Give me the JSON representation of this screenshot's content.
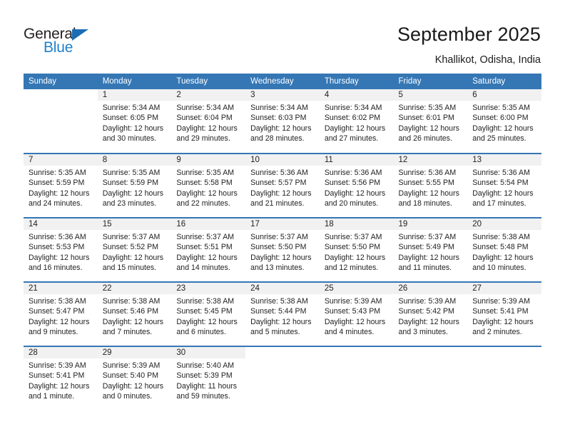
{
  "brand": {
    "name_part1": "General",
    "name_part2": "Blue",
    "accent_color": "#2081cd",
    "triangle_color": "#1b6cb5"
  },
  "header": {
    "month_title": "September 2025",
    "location": "Khallikot, Odisha, India"
  },
  "theme": {
    "header_band": "#3577b5",
    "daynum_band": "#f1f1f1",
    "text": "#222222"
  },
  "weekday_headers": [
    "Sunday",
    "Monday",
    "Tuesday",
    "Wednesday",
    "Thursday",
    "Friday",
    "Saturday"
  ],
  "weeks": [
    [
      {
        "day": "",
        "blank": true,
        "sunrise": "",
        "sunset": "",
        "daylight1": "",
        "daylight2": ""
      },
      {
        "day": "1",
        "sunrise": "Sunrise: 5:34 AM",
        "sunset": "Sunset: 6:05 PM",
        "daylight1": "Daylight: 12 hours",
        "daylight2": "and 30 minutes."
      },
      {
        "day": "2",
        "sunrise": "Sunrise: 5:34 AM",
        "sunset": "Sunset: 6:04 PM",
        "daylight1": "Daylight: 12 hours",
        "daylight2": "and 29 minutes."
      },
      {
        "day": "3",
        "sunrise": "Sunrise: 5:34 AM",
        "sunset": "Sunset: 6:03 PM",
        "daylight1": "Daylight: 12 hours",
        "daylight2": "and 28 minutes."
      },
      {
        "day": "4",
        "sunrise": "Sunrise: 5:34 AM",
        "sunset": "Sunset: 6:02 PM",
        "daylight1": "Daylight: 12 hours",
        "daylight2": "and 27 minutes."
      },
      {
        "day": "5",
        "sunrise": "Sunrise: 5:35 AM",
        "sunset": "Sunset: 6:01 PM",
        "daylight1": "Daylight: 12 hours",
        "daylight2": "and 26 minutes."
      },
      {
        "day": "6",
        "sunrise": "Sunrise: 5:35 AM",
        "sunset": "Sunset: 6:00 PM",
        "daylight1": "Daylight: 12 hours",
        "daylight2": "and 25 minutes."
      }
    ],
    [
      {
        "day": "7",
        "sunrise": "Sunrise: 5:35 AM",
        "sunset": "Sunset: 5:59 PM",
        "daylight1": "Daylight: 12 hours",
        "daylight2": "and 24 minutes."
      },
      {
        "day": "8",
        "sunrise": "Sunrise: 5:35 AM",
        "sunset": "Sunset: 5:59 PM",
        "daylight1": "Daylight: 12 hours",
        "daylight2": "and 23 minutes."
      },
      {
        "day": "9",
        "sunrise": "Sunrise: 5:35 AM",
        "sunset": "Sunset: 5:58 PM",
        "daylight1": "Daylight: 12 hours",
        "daylight2": "and 22 minutes."
      },
      {
        "day": "10",
        "sunrise": "Sunrise: 5:36 AM",
        "sunset": "Sunset: 5:57 PM",
        "daylight1": "Daylight: 12 hours",
        "daylight2": "and 21 minutes."
      },
      {
        "day": "11",
        "sunrise": "Sunrise: 5:36 AM",
        "sunset": "Sunset: 5:56 PM",
        "daylight1": "Daylight: 12 hours",
        "daylight2": "and 20 minutes."
      },
      {
        "day": "12",
        "sunrise": "Sunrise: 5:36 AM",
        "sunset": "Sunset: 5:55 PM",
        "daylight1": "Daylight: 12 hours",
        "daylight2": "and 18 minutes."
      },
      {
        "day": "13",
        "sunrise": "Sunrise: 5:36 AM",
        "sunset": "Sunset: 5:54 PM",
        "daylight1": "Daylight: 12 hours",
        "daylight2": "and 17 minutes."
      }
    ],
    [
      {
        "day": "14",
        "sunrise": "Sunrise: 5:36 AM",
        "sunset": "Sunset: 5:53 PM",
        "daylight1": "Daylight: 12 hours",
        "daylight2": "and 16 minutes."
      },
      {
        "day": "15",
        "sunrise": "Sunrise: 5:37 AM",
        "sunset": "Sunset: 5:52 PM",
        "daylight1": "Daylight: 12 hours",
        "daylight2": "and 15 minutes."
      },
      {
        "day": "16",
        "sunrise": "Sunrise: 5:37 AM",
        "sunset": "Sunset: 5:51 PM",
        "daylight1": "Daylight: 12 hours",
        "daylight2": "and 14 minutes."
      },
      {
        "day": "17",
        "sunrise": "Sunrise: 5:37 AM",
        "sunset": "Sunset: 5:50 PM",
        "daylight1": "Daylight: 12 hours",
        "daylight2": "and 13 minutes."
      },
      {
        "day": "18",
        "sunrise": "Sunrise: 5:37 AM",
        "sunset": "Sunset: 5:50 PM",
        "daylight1": "Daylight: 12 hours",
        "daylight2": "and 12 minutes."
      },
      {
        "day": "19",
        "sunrise": "Sunrise: 5:37 AM",
        "sunset": "Sunset: 5:49 PM",
        "daylight1": "Daylight: 12 hours",
        "daylight2": "and 11 minutes."
      },
      {
        "day": "20",
        "sunrise": "Sunrise: 5:38 AM",
        "sunset": "Sunset: 5:48 PM",
        "daylight1": "Daylight: 12 hours",
        "daylight2": "and 10 minutes."
      }
    ],
    [
      {
        "day": "21",
        "sunrise": "Sunrise: 5:38 AM",
        "sunset": "Sunset: 5:47 PM",
        "daylight1": "Daylight: 12 hours",
        "daylight2": "and 9 minutes."
      },
      {
        "day": "22",
        "sunrise": "Sunrise: 5:38 AM",
        "sunset": "Sunset: 5:46 PM",
        "daylight1": "Daylight: 12 hours",
        "daylight2": "and 7 minutes."
      },
      {
        "day": "23",
        "sunrise": "Sunrise: 5:38 AM",
        "sunset": "Sunset: 5:45 PM",
        "daylight1": "Daylight: 12 hours",
        "daylight2": "and 6 minutes."
      },
      {
        "day": "24",
        "sunrise": "Sunrise: 5:38 AM",
        "sunset": "Sunset: 5:44 PM",
        "daylight1": "Daylight: 12 hours",
        "daylight2": "and 5 minutes."
      },
      {
        "day": "25",
        "sunrise": "Sunrise: 5:39 AM",
        "sunset": "Sunset: 5:43 PM",
        "daylight1": "Daylight: 12 hours",
        "daylight2": "and 4 minutes."
      },
      {
        "day": "26",
        "sunrise": "Sunrise: 5:39 AM",
        "sunset": "Sunset: 5:42 PM",
        "daylight1": "Daylight: 12 hours",
        "daylight2": "and 3 minutes."
      },
      {
        "day": "27",
        "sunrise": "Sunrise: 5:39 AM",
        "sunset": "Sunset: 5:41 PM",
        "daylight1": "Daylight: 12 hours",
        "daylight2": "and 2 minutes."
      }
    ],
    [
      {
        "day": "28",
        "sunrise": "Sunrise: 5:39 AM",
        "sunset": "Sunset: 5:41 PM",
        "daylight1": "Daylight: 12 hours",
        "daylight2": "and 1 minute."
      },
      {
        "day": "29",
        "sunrise": "Sunrise: 5:39 AM",
        "sunset": "Sunset: 5:40 PM",
        "daylight1": "Daylight: 12 hours",
        "daylight2": "and 0 minutes."
      },
      {
        "day": "30",
        "sunrise": "Sunrise: 5:40 AM",
        "sunset": "Sunset: 5:39 PM",
        "daylight1": "Daylight: 11 hours",
        "daylight2": "and 59 minutes."
      },
      {
        "day": "",
        "blank": true,
        "sunrise": "",
        "sunset": "",
        "daylight1": "",
        "daylight2": ""
      },
      {
        "day": "",
        "blank": true,
        "sunrise": "",
        "sunset": "",
        "daylight1": "",
        "daylight2": ""
      },
      {
        "day": "",
        "blank": true,
        "sunrise": "",
        "sunset": "",
        "daylight1": "",
        "daylight2": ""
      },
      {
        "day": "",
        "blank": true,
        "sunrise": "",
        "sunset": "",
        "daylight1": "",
        "daylight2": ""
      }
    ]
  ]
}
